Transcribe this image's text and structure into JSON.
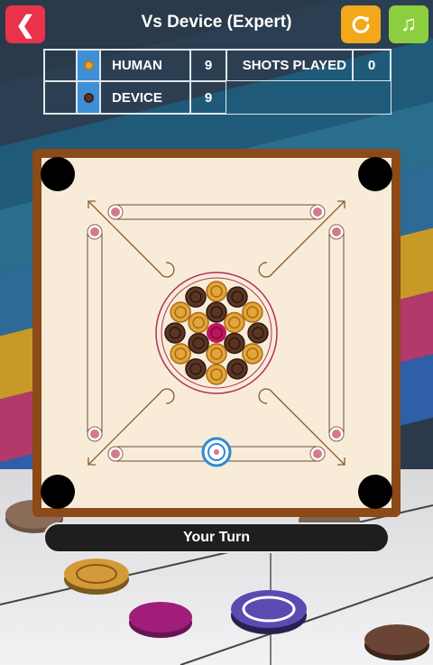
{
  "header": {
    "title": "Vs Device (Expert)",
    "back_icon": "back-arrow-icon",
    "restart_icon": "restart-icon",
    "music_icon": "music-note-icon"
  },
  "scoreboard": {
    "players": [
      {
        "name": "HUMAN",
        "score": "9",
        "coin_icon": "light-coin-icon"
      },
      {
        "name": "DEVICE",
        "score": "9",
        "coin_icon": "dark-coin-icon"
      }
    ],
    "shots_label": "SHOTS PLAYED",
    "shots_value": "0"
  },
  "status": {
    "turn_text": "Your Turn"
  },
  "colors": {
    "back_button": "#e8334a",
    "restart_button": "#f3a81b",
    "music_button": "#8ccf3e",
    "board_frame": "#8b4a17",
    "board_surface": "#f8ecd8",
    "queen": "#c0145f",
    "light_coin": "#e2a63a",
    "dark_coin": "#5b3524"
  }
}
